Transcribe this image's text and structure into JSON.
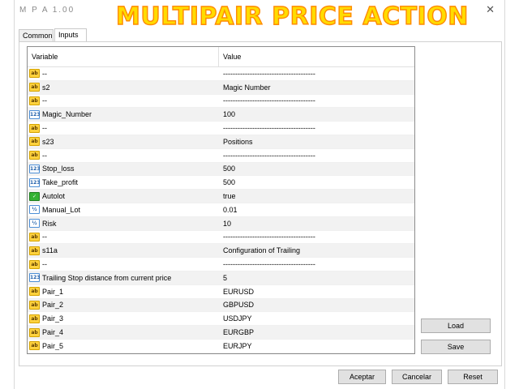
{
  "window": {
    "title": "M P A 1.00",
    "close_glyph": "✕",
    "banner_text": "MULTIPAIR PRICE ACTION",
    "banner_fill_color": "#ffdc00",
    "banner_outline_color": "#ff8a00"
  },
  "tabs": [
    {
      "label": "Common",
      "active": false
    },
    {
      "label": "Inputs",
      "active": true
    }
  ],
  "grid": {
    "headers": {
      "variable": "Variable",
      "value": "Value"
    },
    "rows": [
      {
        "icon": "ab",
        "icon_text": "ab",
        "variable": "--",
        "value": "--------------------------------------"
      },
      {
        "icon": "ab",
        "icon_text": "ab",
        "variable": "s2",
        "value": "Magic Number"
      },
      {
        "icon": "ab",
        "icon_text": "ab",
        "variable": "--",
        "value": "--------------------------------------"
      },
      {
        "icon": "n123",
        "icon_text": "123",
        "variable": "Magic_Number",
        "value": "100"
      },
      {
        "icon": "ab",
        "icon_text": "ab",
        "variable": "--",
        "value": "--------------------------------------"
      },
      {
        "icon": "ab",
        "icon_text": "ab",
        "variable": "s23",
        "value": "Positions"
      },
      {
        "icon": "ab",
        "icon_text": "ab",
        "variable": "--",
        "value": "--------------------------------------"
      },
      {
        "icon": "n123",
        "icon_text": "123",
        "variable": "Stop_loss",
        "value": "500"
      },
      {
        "icon": "n123",
        "icon_text": "123",
        "variable": "Take_profit",
        "value": "500"
      },
      {
        "icon": "bool",
        "icon_text": "✓",
        "variable": "Autolot",
        "value": "true"
      },
      {
        "icon": "half",
        "icon_text": "½",
        "variable": "Manual_Lot",
        "value": "0.01"
      },
      {
        "icon": "half",
        "icon_text": "½",
        "variable": "Risk",
        "value": "10"
      },
      {
        "icon": "ab",
        "icon_text": "ab",
        "variable": "--",
        "value": "--------------------------------------"
      },
      {
        "icon": "ab",
        "icon_text": "ab",
        "variable": "s11a",
        "value": "Configuration of Trailing"
      },
      {
        "icon": "ab",
        "icon_text": "ab",
        "variable": "--",
        "value": "--------------------------------------"
      },
      {
        "icon": "n123",
        "icon_text": "123",
        "variable": "Trailing Stop distance from current price",
        "value": "5"
      },
      {
        "icon": "ab",
        "icon_text": "ab",
        "variable": "Pair_1",
        "value": "EURUSD"
      },
      {
        "icon": "ab",
        "icon_text": "ab",
        "variable": "Pair_2",
        "value": "GBPUSD"
      },
      {
        "icon": "ab",
        "icon_text": "ab",
        "variable": "Pair_3",
        "value": "USDJPY"
      },
      {
        "icon": "ab",
        "icon_text": "ab",
        "variable": "Pair_4",
        "value": "EURGBP"
      },
      {
        "icon": "ab",
        "icon_text": "ab",
        "variable": "Pair_5",
        "value": "EURJPY"
      }
    ]
  },
  "buttons": {
    "load": "Load",
    "save": "Save",
    "ok": "Aceptar",
    "cancel": "Cancelar",
    "reset": "Reset"
  }
}
